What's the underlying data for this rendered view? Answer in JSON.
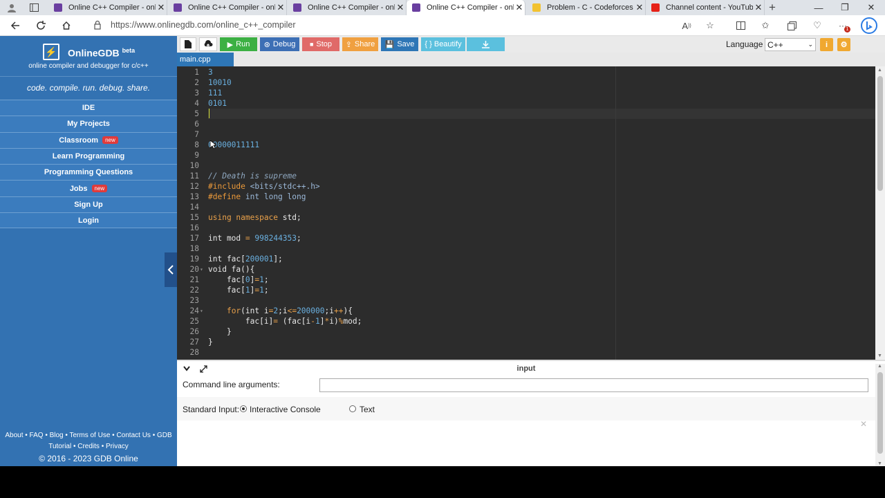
{
  "browser": {
    "tabs": [
      {
        "title": "Online C++ Compiler - onl",
        "favicon_color": "#6a3fa0",
        "active": false
      },
      {
        "title": "Online C++ Compiler - onl",
        "favicon_color": "#6a3fa0",
        "active": false
      },
      {
        "title": "Online C++ Compiler - onl",
        "favicon_color": "#6a3fa0",
        "active": false
      },
      {
        "title": "Online C++ Compiler - onl",
        "favicon_color": "#6a3fa0",
        "active": true
      },
      {
        "title": "Problem - C - Codeforces",
        "favicon_color": "#f2c230",
        "active": false
      },
      {
        "title": "Channel content - YouTube",
        "favicon_color": "#e62117",
        "active": false
      }
    ],
    "new_tab": "+",
    "url": "https://www.onlinegdb.com/online_c++_compiler",
    "notification_count": "1"
  },
  "sidebar": {
    "brand": "OnlineGDB",
    "brand_sup": "beta",
    "brand_sub": "online compiler and debugger for c/c++",
    "tagline": "code. compile. run. debug. share.",
    "menu": [
      {
        "label": "IDE",
        "badge": ""
      },
      {
        "label": "My Projects",
        "badge": ""
      },
      {
        "label": "Classroom",
        "badge": "new"
      },
      {
        "label": "Learn Programming",
        "badge": ""
      },
      {
        "label": "Programming Questions",
        "badge": ""
      },
      {
        "label": "Jobs",
        "badge": "new"
      },
      {
        "label": "Sign Up",
        "badge": ""
      },
      {
        "label": "Login",
        "badge": ""
      }
    ],
    "footer": {
      "line1": "About • FAQ • Blog • Terms of Use • Contact Us • GDB",
      "line2": "Tutorial • Credits • Privacy",
      "copyright": "© 2016 - 2023 GDB Online"
    }
  },
  "toolbar": {
    "run": "Run",
    "debug": "Debug",
    "stop": "Stop",
    "share": "Share",
    "save": "Save",
    "beautify": "{ } Beautify",
    "language_label": "Language",
    "language_value": "C++",
    "colors": {
      "run": "#3cb043",
      "debug": "#3d6fb5",
      "stop": "#d9534f",
      "share": "#f0a040",
      "save": "#2e76b6",
      "beautify": "#5bc0de",
      "download": "#5bc0de"
    }
  },
  "editor": {
    "file_tab": "main.cpp",
    "lines": [
      {
        "n": "1",
        "html": "<span class=\"n\">3</span>"
      },
      {
        "n": "2",
        "html": "<span class=\"n\">10010</span>"
      },
      {
        "n": "3",
        "html": "<span class=\"n\">111</span>"
      },
      {
        "n": "4",
        "html": "<span class=\"n\">0101</span>"
      },
      {
        "n": "5",
        "html": ""
      },
      {
        "n": "6",
        "html": ""
      },
      {
        "n": "7",
        "html": ""
      },
      {
        "n": "8",
        "html": "<span class=\"n\">00000011111</span>"
      },
      {
        "n": "9",
        "html": ""
      },
      {
        "n": "10",
        "html": ""
      },
      {
        "n": "11",
        "html": "<span class=\"c\">// Death is supreme</span>"
      },
      {
        "n": "12",
        "html": "<span class=\"pp\">#include</span> <span class=\"inc\">&lt;bits/stdc++.h&gt;</span>"
      },
      {
        "n": "13",
        "html": "<span class=\"pp\">#define</span> <span class=\"inc\">int long long</span>"
      },
      {
        "n": "14",
        "html": ""
      },
      {
        "n": "15",
        "html": "<span class=\"k\">using namespace</span> std;"
      },
      {
        "n": "16",
        "html": ""
      },
      {
        "n": "17",
        "html": "int mod <span class=\"op\">=</span> <span class=\"n\">998244353</span>;"
      },
      {
        "n": "18",
        "html": ""
      },
      {
        "n": "19",
        "html": "int fac[<span class=\"n\">200001</span>];"
      },
      {
        "n": "20",
        "html": "void fa(){",
        "fold": true
      },
      {
        "n": "21",
        "html": "    fac[<span class=\"n\">0</span>]<span class=\"op\">=</span><span class=\"n\">1</span>;"
      },
      {
        "n": "22",
        "html": "    fac[<span class=\"n\">1</span>]<span class=\"op\">=</span><span class=\"n\">1</span>;"
      },
      {
        "n": "23",
        "html": ""
      },
      {
        "n": "24",
        "html": "    <span class=\"k\">for</span>(int i<span class=\"op\">=</span><span class=\"n\">2</span>;i<span class=\"op\">&lt;=</span><span class=\"n\">200000</span>;i<span class=\"op\">++</span>){",
        "fold": true
      },
      {
        "n": "25",
        "html": "        fac[i]<span class=\"op\">=</span> (fac[i<span class=\"op\">-</span><span class=\"n\">1</span>]<span class=\"op\">*</span>i)<span class=\"op\">%</span>mod;"
      },
      {
        "n": "26",
        "html": "    }"
      },
      {
        "n": "27",
        "html": "}"
      },
      {
        "n": "28",
        "html": ""
      }
    ],
    "cursor_line": 5
  },
  "input_panel": {
    "title": "input",
    "args_label": "Command line arguments:",
    "args_value": "",
    "stdin_label": "Standard Input:",
    "option_interactive": "Interactive Console",
    "option_text": "Text",
    "selected": "interactive"
  }
}
